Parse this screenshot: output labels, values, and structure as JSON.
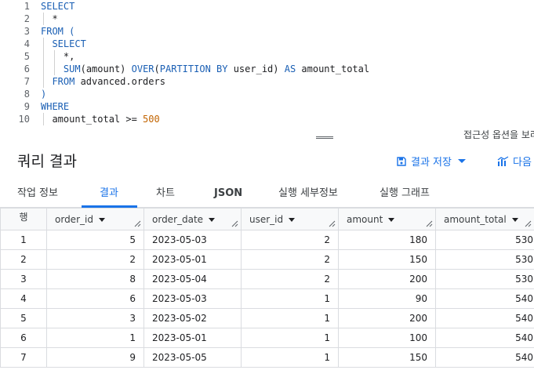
{
  "editor": {
    "lines": [
      {
        "n": "1",
        "parts": [
          {
            "t": "SELECT",
            "c": "kw"
          }
        ]
      },
      {
        "n": "2",
        "parts": [
          {
            "t": "  *",
            "c": ""
          }
        ]
      },
      {
        "n": "3",
        "parts": [
          {
            "t": "FROM",
            "c": "kw"
          },
          {
            "t": " (",
            "c": "kw"
          }
        ]
      },
      {
        "n": "4",
        "parts": [
          {
            "t": "  ",
            "c": ""
          },
          {
            "t": "SELECT",
            "c": "kw"
          }
        ]
      },
      {
        "n": "5",
        "parts": [
          {
            "t": "    *,",
            "c": ""
          }
        ]
      },
      {
        "n": "6",
        "parts": [
          {
            "t": "    ",
            "c": ""
          },
          {
            "t": "SUM",
            "c": "kw"
          },
          {
            "t": "(amount) ",
            "c": ""
          },
          {
            "t": "OVER",
            "c": "kw"
          },
          {
            "t": "(",
            "c": ""
          },
          {
            "t": "PARTITION BY",
            "c": "kw"
          },
          {
            "t": " user_id) ",
            "c": ""
          },
          {
            "t": "AS",
            "c": "kw"
          },
          {
            "t": " amount_total",
            "c": ""
          }
        ]
      },
      {
        "n": "7",
        "parts": [
          {
            "t": "  ",
            "c": ""
          },
          {
            "t": "FROM",
            "c": "kw"
          },
          {
            "t": " advanced.orders",
            "c": ""
          }
        ]
      },
      {
        "n": "8",
        "parts": [
          {
            "t": ")",
            "c": "kw"
          }
        ]
      },
      {
        "n": "9",
        "parts": [
          {
            "t": "WHERE",
            "c": "kw"
          }
        ]
      },
      {
        "n": "10",
        "parts": [
          {
            "t": "  amount_total >= ",
            "c": ""
          },
          {
            "t": "500",
            "c": "num"
          }
        ]
      }
    ]
  },
  "a11y_hint": "접근성 옵션을 보려",
  "results": {
    "title": "쿼리 결과",
    "save_label": "결과 저장",
    "next_label": "다음"
  },
  "tabs": [
    {
      "label": "작업 정보",
      "active": false
    },
    {
      "label": "결과",
      "active": true
    },
    {
      "label": "차트",
      "active": false
    },
    {
      "label": "JSON",
      "active": false
    },
    {
      "label": "실행 세부정보",
      "active": false
    },
    {
      "label": "실행 그래프",
      "active": false
    }
  ],
  "table": {
    "row_header": "행",
    "columns": [
      "order_id",
      "order_date",
      "user_id",
      "amount",
      "amount_total"
    ],
    "rows": [
      [
        "1",
        "5",
        "2023-05-03",
        "2",
        "180",
        "530"
      ],
      [
        "2",
        "2",
        "2023-05-01",
        "2",
        "150",
        "530"
      ],
      [
        "3",
        "8",
        "2023-05-04",
        "2",
        "200",
        "530"
      ],
      [
        "4",
        "6",
        "2023-05-03",
        "1",
        "90",
        "540"
      ],
      [
        "5",
        "3",
        "2023-05-02",
        "1",
        "200",
        "540"
      ],
      [
        "6",
        "1",
        "2023-05-01",
        "1",
        "100",
        "540"
      ],
      [
        "7",
        "9",
        "2023-05-05",
        "1",
        "150",
        "540"
      ]
    ]
  }
}
